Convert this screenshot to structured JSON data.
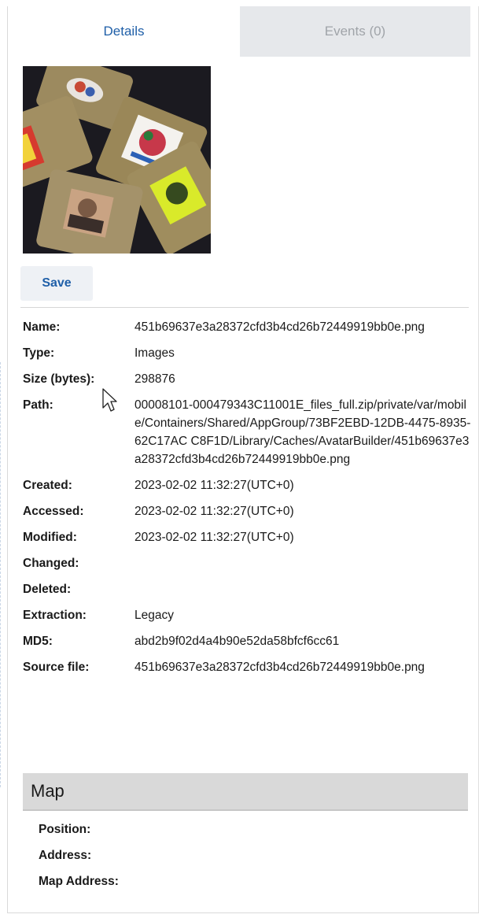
{
  "tabs": [
    {
      "label": "Details",
      "active": true
    },
    {
      "label": "Events (0)",
      "active": false
    }
  ],
  "thumbnail": {
    "icon": "image-thumbnail"
  },
  "save_label": "Save",
  "properties": [
    {
      "key": "Name:",
      "value": "451b69637e3a28372cfd3b4cd26b72449919bb0e.png"
    },
    {
      "key": "Type:",
      "value": "Images"
    },
    {
      "key": "Size (bytes):",
      "value": "298876"
    },
    {
      "key": "Path:",
      "value": "00008101-000479343C11001E_files_full.zip/private/var/mobile/Containers/Shared/AppGroup/73BF2EBD-12DB-4475-8935-62C17AC C8F1D/Library/Caches/AvatarBuilder/451b69637e3a28372cfd3b4cd26b72449919bb0e.png"
    },
    {
      "key": "Created:",
      "value": "2023-02-02 11:32:27(UTC+0)"
    },
    {
      "key": "Accessed:",
      "value": "2023-02-02 11:32:27(UTC+0)"
    },
    {
      "key": "Modified:",
      "value": "2023-02-02 11:32:27(UTC+0)"
    },
    {
      "key": "Changed:",
      "value": ""
    },
    {
      "key": "Deleted:",
      "value": ""
    },
    {
      "key": "Extraction:",
      "value": "Legacy"
    },
    {
      "key": "MD5:",
      "value": "abd2b9f02d4a4b90e52da58bfcf6cc61"
    },
    {
      "key": "Source file:",
      "value": "451b69637e3a28372cfd3b4cd26b72449919bb0e.png"
    }
  ],
  "map": {
    "title": "Map",
    "fields": [
      {
        "key": "Position:",
        "value": ""
      },
      {
        "key": "Address:",
        "value": ""
      },
      {
        "key": "Map Address:",
        "value": ""
      }
    ]
  },
  "colors": {
    "accent": "#1f5fa8",
    "tab_inactive_bg": "#e6e8eb",
    "map_header_bg": "#d9d9d9"
  }
}
